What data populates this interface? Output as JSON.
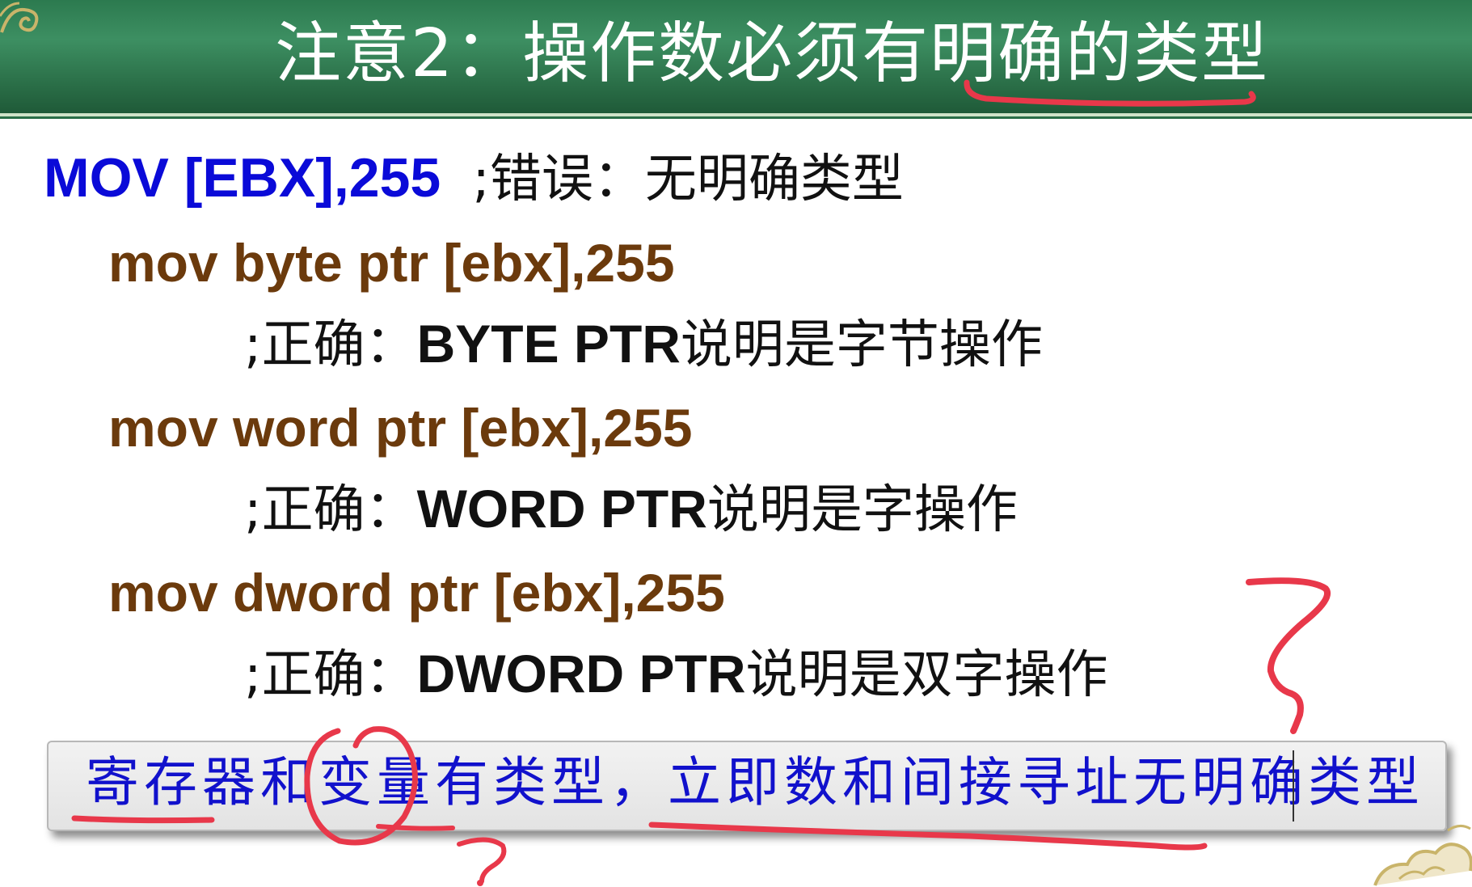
{
  "slide": {
    "title": "注意2：操作数必须有明确的类型",
    "lines": [
      {
        "code": "MOV [EBX],255",
        "comment": ";错误：无明确类型"
      },
      {
        "code": "mov byte ptr [ebx],255"
      },
      {
        "comment_prefix": ";正确：",
        "comment_keyword": "BYTE PTR",
        "comment_suffix": "说明是字节操作"
      },
      {
        "code": "mov word ptr [ebx],255"
      },
      {
        "comment_prefix": ";正确：",
        "comment_keyword": "WORD PTR",
        "comment_suffix": "说明是字操作"
      },
      {
        "code": "mov dword ptr [ebx],255"
      },
      {
        "comment_prefix": ";正确：",
        "comment_keyword": "DWORD PTR",
        "comment_suffix": "说明是双字操作"
      }
    ],
    "summary": "寄存器和变量有类型，立即数和间接寻址无明确类型"
  },
  "colors": {
    "banner": "#2c7a4f",
    "title_text": "#ffffff",
    "code_blue": "#0a0ad8",
    "code_brown": "#6b3a0c",
    "summary_text": "#1111cc",
    "annotation_ink": "#e8384a"
  },
  "icons": {
    "top_left": "corner-ornament-icon",
    "bottom_right": "cloud-ornament-icon"
  }
}
